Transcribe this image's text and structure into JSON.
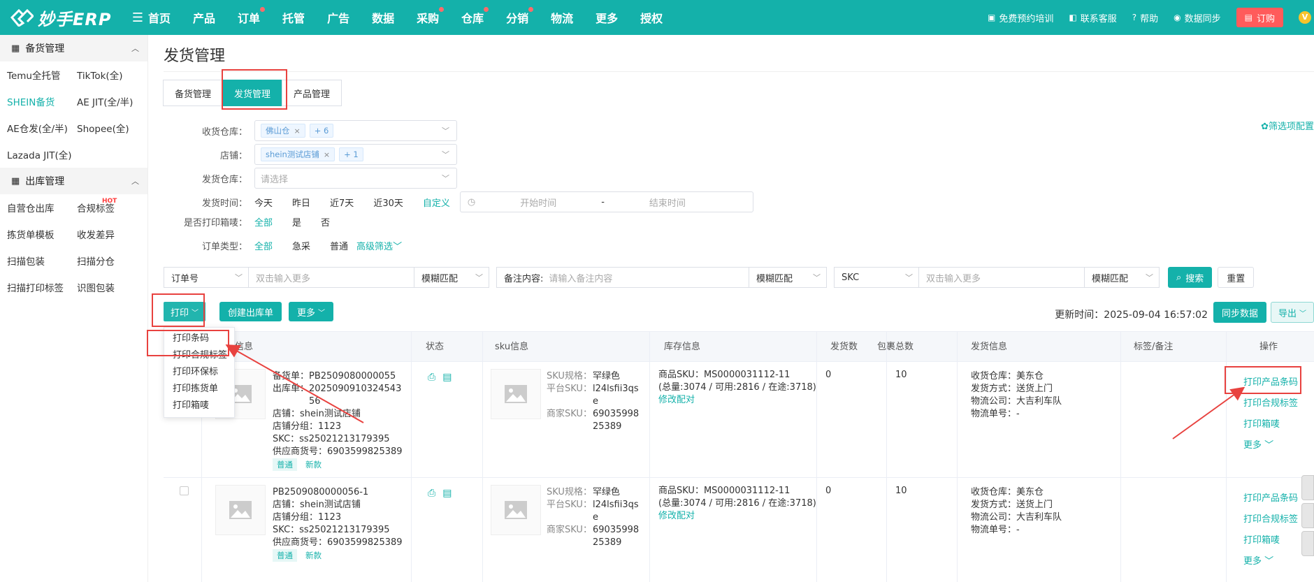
{
  "brand": {
    "name": "妙手ERP"
  },
  "topnav": {
    "items": [
      {
        "label": "首页",
        "dot": false
      },
      {
        "label": "产品",
        "dot": false
      },
      {
        "label": "订单",
        "dot": true
      },
      {
        "label": "托管",
        "dot": false
      },
      {
        "label": "广告",
        "dot": false
      },
      {
        "label": "数据",
        "dot": false
      },
      {
        "label": "采购",
        "dot": true
      },
      {
        "label": "仓库",
        "dot": true
      },
      {
        "label": "分销",
        "dot": true
      },
      {
        "label": "物流",
        "dot": false
      },
      {
        "label": "更多",
        "dot": false
      },
      {
        "label": "授权",
        "dot": false
      }
    ],
    "right": {
      "training": "免费预约培训",
      "service": "联系客服",
      "help": "帮助",
      "sync": "数据同步",
      "order": "订购",
      "avatar_badge": "V"
    }
  },
  "sidebar": {
    "group1": {
      "title": "备货管理"
    },
    "group1_items": [
      "Temu全托管",
      "TikTok(全)",
      "SHEIN备货",
      "AE JIT(全/半)",
      "AE仓发(全/半)",
      "Shopee(全)",
      "Lazada JIT(全)"
    ],
    "group2": {
      "title": "出库管理"
    },
    "group2_items": [
      "自营仓出库",
      "合规标签",
      "拣货单模板",
      "收发差异",
      "扫描包装",
      "扫描分仓",
      "扫描打印标签",
      "识图包装"
    ],
    "hot": "HOT"
  },
  "page": {
    "title": "发货管理",
    "tabs": [
      "备货管理",
      "发货管理",
      "产品管理"
    ],
    "filter_config": "筛选项配置"
  },
  "filters": {
    "receive_wh_label": "收货仓库：",
    "receive_wh_tag": "佛山仓",
    "receive_wh_more": "+ 6",
    "store_label": "店铺：",
    "store_tag": "shein测试店铺",
    "store_more": "+ 1",
    "ship_wh_label": "发货仓库：",
    "ship_wh_placeholder": "请选择",
    "ship_time_label": "发货时间：",
    "ship_time_opts": [
      "今天",
      "昨日",
      "近7天",
      "近30天",
      "自定义"
    ],
    "start_time": "开始时间",
    "end_time": "结束时间",
    "date_sep": "-",
    "printed_label": "是否打印箱唛：",
    "printed_opts": [
      "全部",
      "是",
      "否"
    ],
    "order_type_label": "订单类型：",
    "order_type_opts": [
      "全部",
      "急采",
      "普通"
    ],
    "advanced": "高级筛选"
  },
  "search": {
    "field1": "订单号",
    "input1_placeholder": "双击输入更多",
    "match1": "模糊匹配",
    "remark_label": "备注内容:",
    "remark_placeholder": "请输入备注内容",
    "match2": "模糊匹配",
    "field3": "SKC",
    "input3_placeholder": "双击输入更多",
    "match3": "模糊匹配",
    "search_btn": "搜索",
    "reset_btn": "重置"
  },
  "actions": {
    "print": "打印",
    "create": "创建出库单",
    "more": "更多",
    "update_label": "更新时间：",
    "update_time": "2025-09-04 16:57:02",
    "sync": "同步数据",
    "export": "导出"
  },
  "print_menu": [
    "打印条码",
    "打印合规标签",
    "打印环保标",
    "打印拣货单",
    "打印箱唛"
  ],
  "table": {
    "headers": [
      "信息",
      "状态",
      "sku信息",
      "库存信息",
      "发货数",
      "包裹总数",
      "发货信息",
      "标签/备注",
      "操作"
    ],
    "rows": [
      {
        "ship_no": "备货单：PB2509080000055",
        "out_no_1": "出库单：2025090910324543",
        "out_no_2": "56",
        "store": "店铺：shein测试店铺",
        "store_group": "店铺分组：1123",
        "skc": "SKC：ss25021213179395",
        "supplier": "供应商货号：6903599825389",
        "tag1": "普通",
        "tag2": "新款",
        "sku_spec_label": "SKU规格：",
        "sku_spec": "罕绿色",
        "platform_sku_label": "平台SKU：",
        "platform_sku_1": "l24lsfii3qs",
        "platform_sku_2": "e",
        "merchant_sku_label": "商家SKU：",
        "merchant_sku_1": "69035998",
        "merchant_sku_2": "25389",
        "goods_sku": "商品SKU：MS0000031112-11",
        "stock": "(总量:3074 / 可用:2816 / 在途:3718)",
        "fix_pair": "修改配对",
        "ship_qty": "0",
        "pkg_total": "10",
        "recv_wh": "收货仓库：美东仓",
        "ship_method": "发货方式：送货上门",
        "logistics": "物流公司：大吉利车队",
        "tracking": "物流单号：-",
        "ops": [
          "打印产品条码",
          "打印合规标签",
          "打印箱唛",
          "更多"
        ]
      },
      {
        "ship_no": "PB2509080000056-1",
        "store": "店铺：shein测试店铺",
        "store_group": "店铺分组：1123",
        "skc": "SKC：ss25021213179395",
        "supplier": "供应商货号：6903599825389",
        "tag1": "普通",
        "tag2": "新款",
        "sku_spec_label": "SKU规格：",
        "sku_spec": "罕绿色",
        "platform_sku_label": "平台SKU：",
        "platform_sku_1": "l24lsfii3qs",
        "platform_sku_2": "e",
        "merchant_sku_label": "商家SKU：",
        "merchant_sku_1": "69035998",
        "merchant_sku_2": "25389",
        "goods_sku": "商品SKU：MS0000031112-11",
        "stock": "(总量:3074 / 可用:2816 / 在途:3718)",
        "fix_pair": "修改配对",
        "ship_qty": "0",
        "pkg_total": "10",
        "recv_wh": "收货仓库：美东仓",
        "ship_method": "发货方式：送货上门",
        "logistics": "物流公司：大吉利车队",
        "tracking": "物流单号：-",
        "ops": [
          "打印产品条码",
          "打印合规标签",
          "打印箱唛",
          "更多"
        ]
      }
    ]
  },
  "colors": {
    "brand": "#14b1aa",
    "annotation": "#e8423f"
  }
}
